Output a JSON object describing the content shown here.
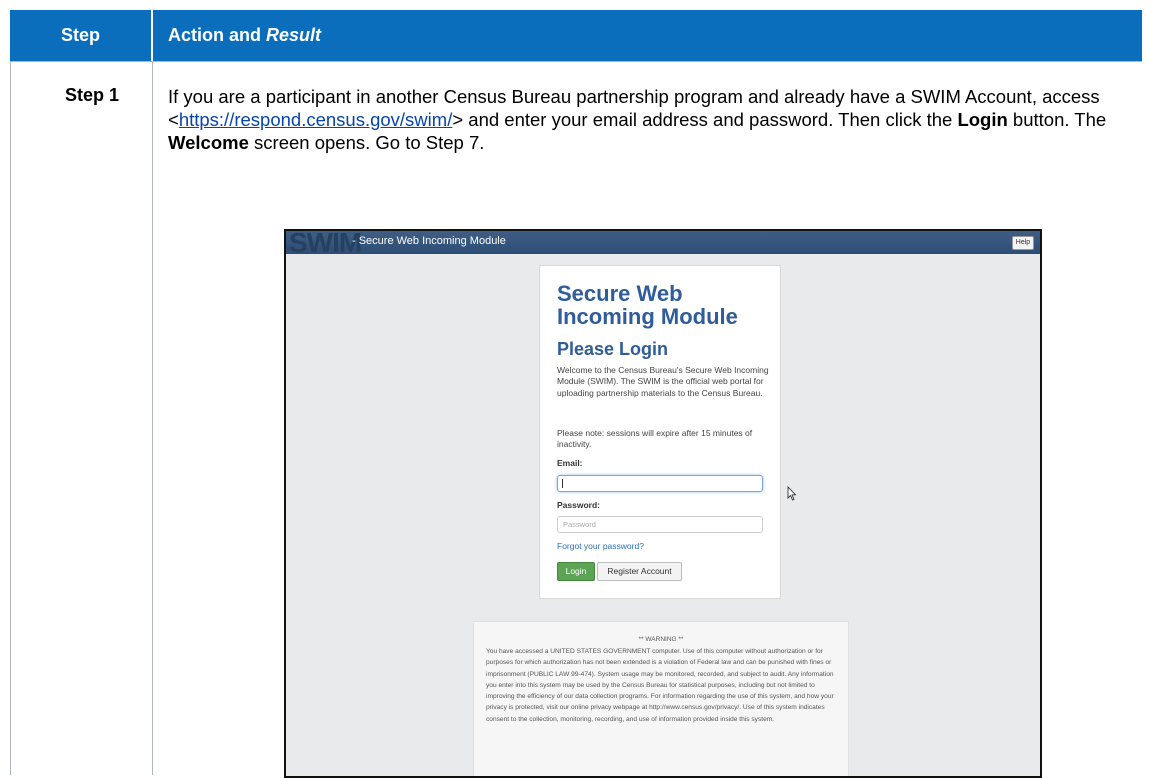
{
  "table": {
    "header_step": "Step",
    "header_action": "Action and",
    "header_result": "Result",
    "step_label": "Step 1",
    "instruction": {
      "part1": "If you are a participant in another Census Bureau partnership program and already have a SWIM Account, access <",
      "link": "https://respond.census.gov/swim/",
      "part2": "> and enter your email address and password. Then click the ",
      "login_word": "Login",
      "part3": " button. The ",
      "welcome_word": "Welcome",
      "part4": " screen opens. Go to Step 7."
    }
  },
  "screenshot": {
    "logo": "SWIM",
    "bar_title": "- Secure Web Incoming Module",
    "help": "Help",
    "card_title": "Secure Web Incoming Module",
    "card_subtitle": "Please Login",
    "description": "Welcome to the Census Bureau's Secure Web Incoming Module (SWIM). The SWIM is the official web portal for uploading partnership materials to the Census Bureau.",
    "note": "Please note: sessions will expire after 15 minutes of inactivity.",
    "email_label": "Email:",
    "email_value": "",
    "password_label": "Password:",
    "password_placeholder": "Password",
    "forgot": "Forgot your password?",
    "login_button": "Login",
    "register_button": "Register Account",
    "warning_title": "** WARNING **",
    "warning_text": "You have accessed a UNITED STATES GOVERNMENT computer. Use of this computer without authorization or for purposes for which authorization has not been extended is a violation of Federal law and can be punished with fines or imprisonment (PUBLIC LAW 99-474). System usage may be monitored, recorded, and subject to audit. Any information you enter into this system may be used by the Census Bureau for statistical purposes, including but not limited to improving the efficiency of our data collection programs. For information regarding the use of this system, and how your privacy is protected, visit our online privacy webpage at http://www.census.gov/privacy/. Use of this system indicates consent to the collection, monitoring, recording, and use of information provided inside this system."
  },
  "colors": {
    "header_bg": "#0a6ebd",
    "swim_bar": "#2d4d74",
    "title_blue": "#2f5d9a",
    "login_green": "#5aa454"
  }
}
